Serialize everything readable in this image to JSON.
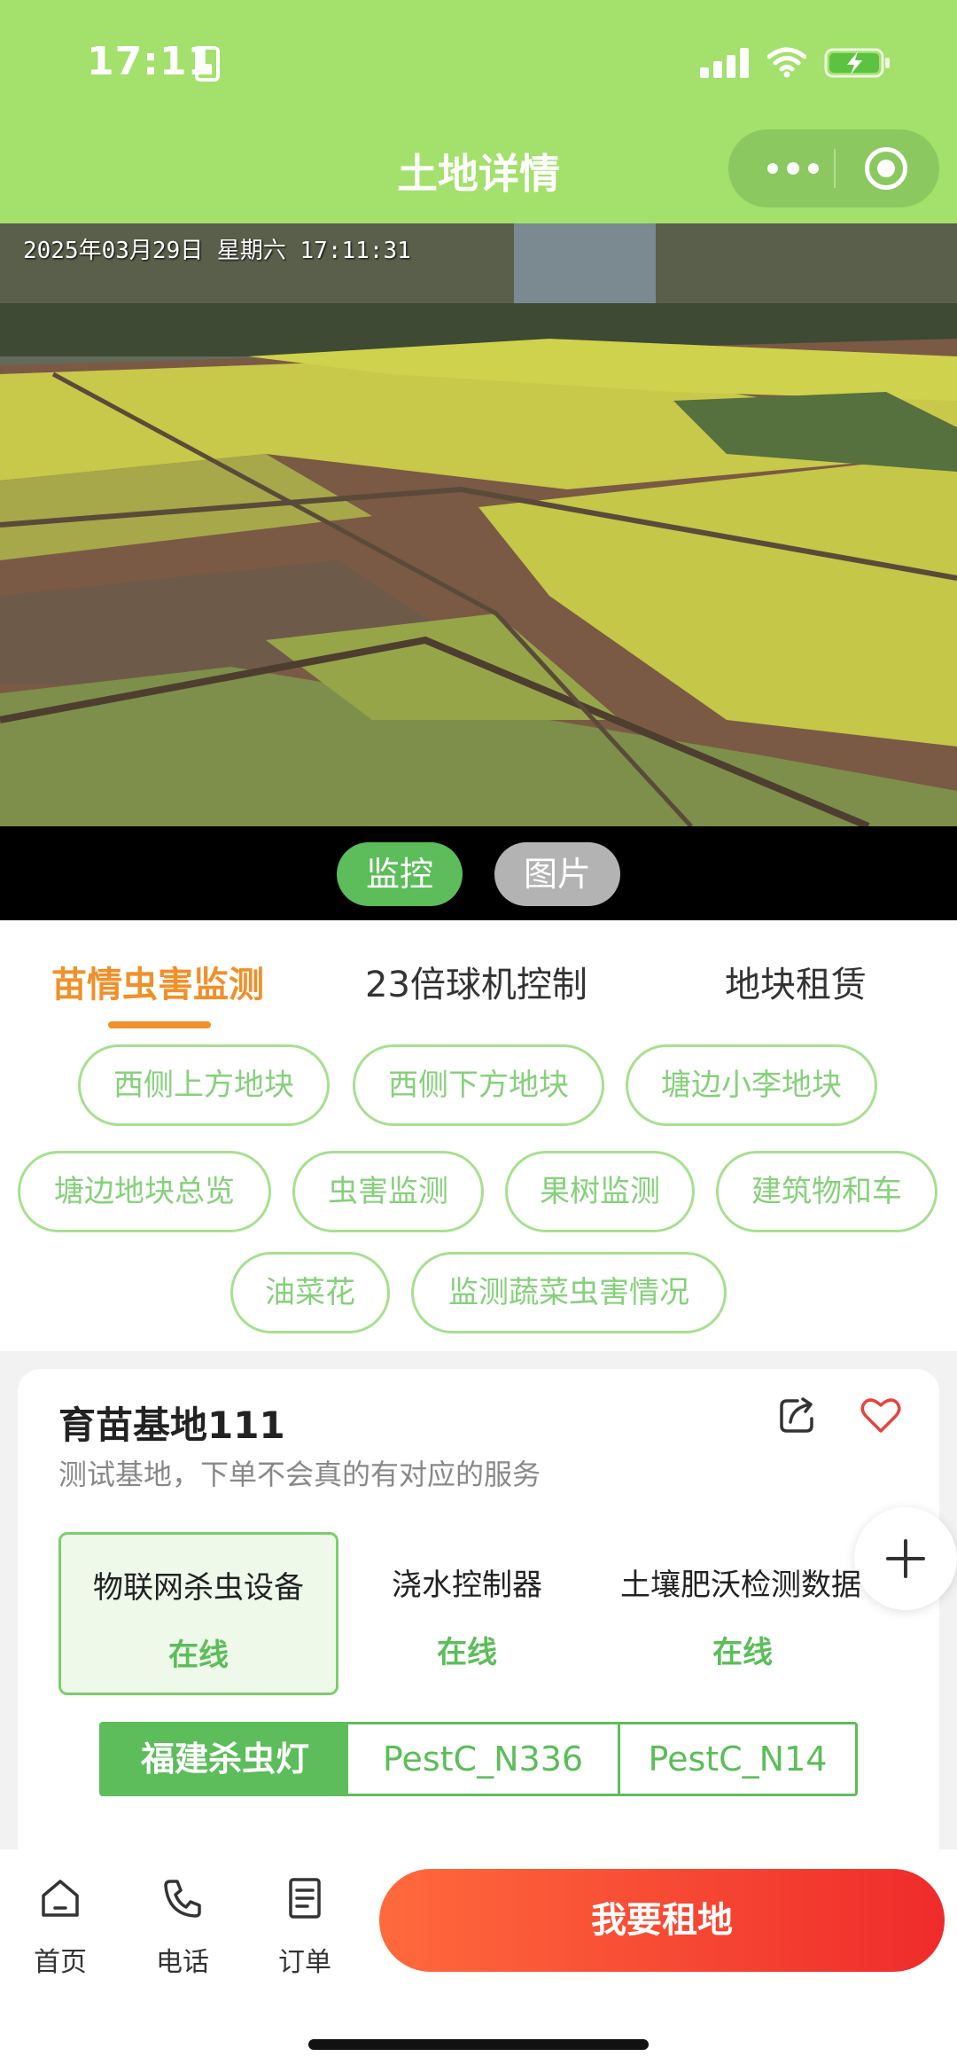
{
  "status_bar": {
    "time": "17:11"
  },
  "header": {
    "title": "土地详情"
  },
  "video": {
    "timestamp": "2025年03月29日 星期六 17:11:31",
    "mode_buttons": [
      "监控",
      "图片"
    ]
  },
  "tabs": [
    "苗情虫害监测",
    "23倍球机控制",
    "地块租赁"
  ],
  "chips": [
    "西侧上方地块",
    "西侧下方地块",
    "塘边小李地块",
    "塘边地块总览",
    "虫害监测",
    "果树监测",
    "建筑物和车",
    "油菜花",
    "监测蔬菜虫害情况"
  ],
  "base": {
    "name": "育苗基地111",
    "description": "测试基地，下单不会真的有对应的服务"
  },
  "devices": [
    {
      "name": "物联网杀虫设备",
      "status": "在线"
    },
    {
      "name": "浇水控制器",
      "status": "在线"
    },
    {
      "name": "土壤肥沃检测数据",
      "status": "在线"
    }
  ],
  "device_units": [
    "福建杀虫灯",
    "PestC_N336",
    "PestC_N14"
  ],
  "bottom_nav": {
    "items": [
      "首页",
      "电话",
      "订单"
    ],
    "rent_button": "我要租地"
  },
  "colors": {
    "header_green": "#a3e06c",
    "accent_green": "#5cbd5a",
    "tab_orange": "#f0902a",
    "rent_red": "#ef2b2b"
  }
}
